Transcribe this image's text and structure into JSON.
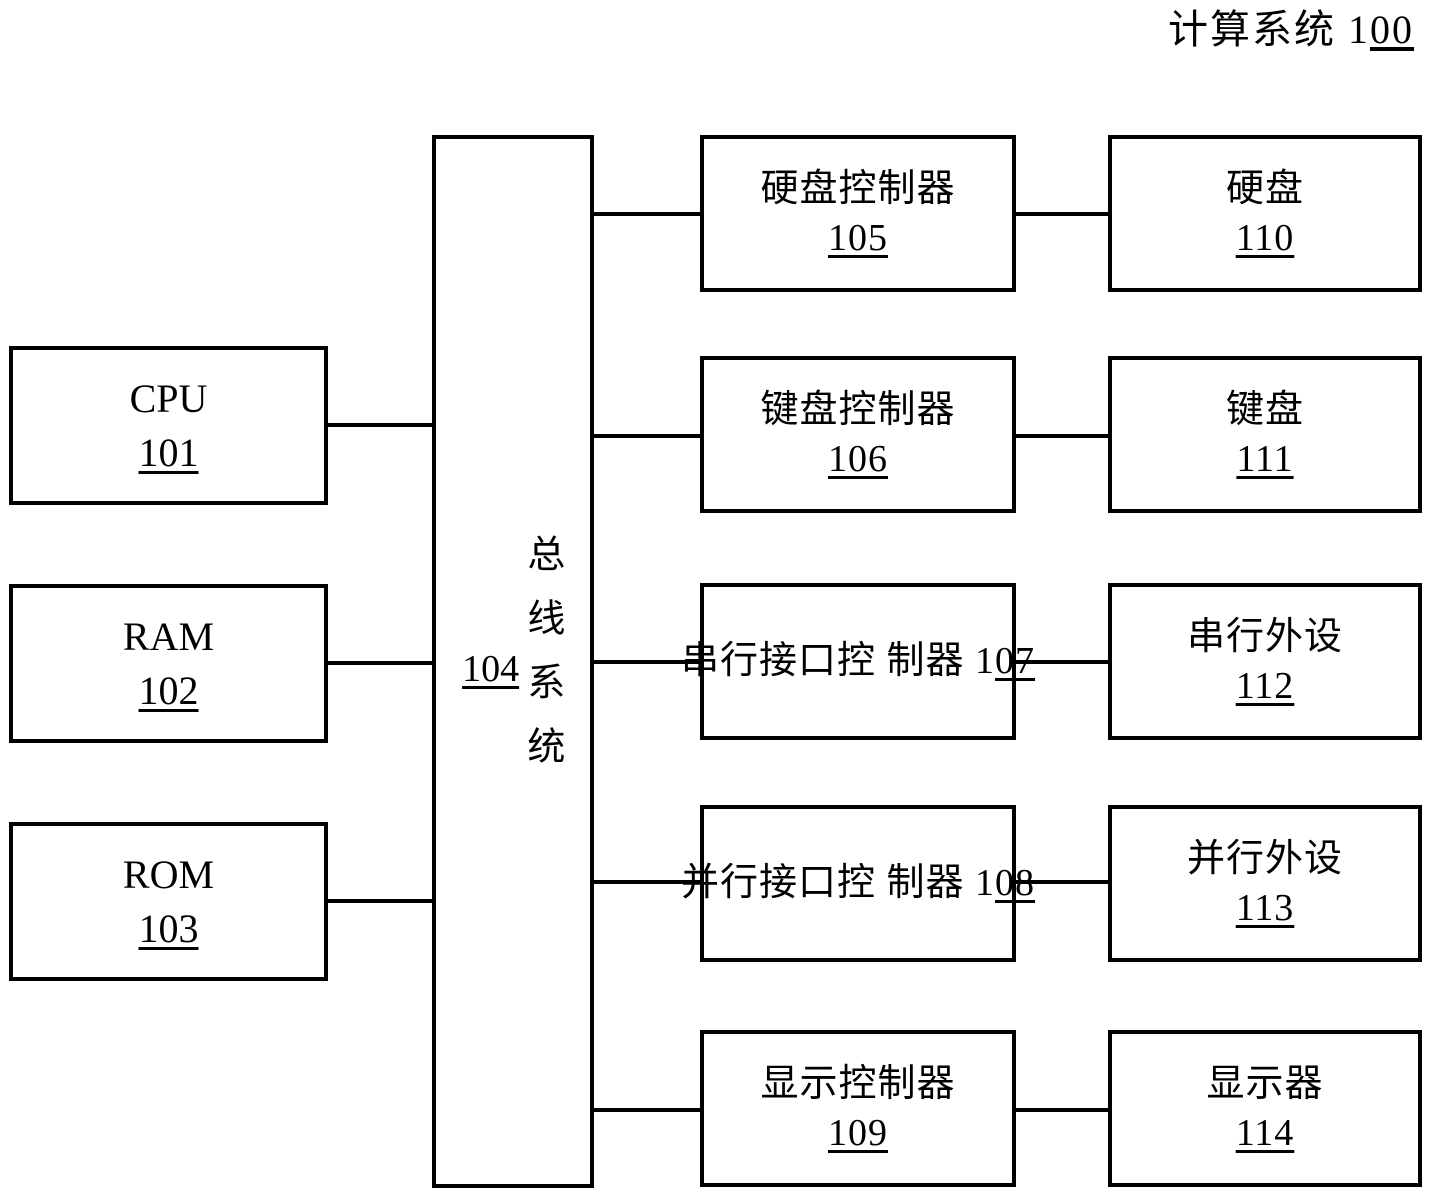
{
  "figure": {
    "title_text": "计算系统 ",
    "title_num_prefix": "1",
    "title_num_underlined": "00"
  },
  "core": {
    "cpu": {
      "label": "CPU",
      "id": "101"
    },
    "ram": {
      "label": "RAM",
      "id": "102"
    },
    "rom": {
      "label": "ROM",
      "id": "103"
    }
  },
  "bus": {
    "label": "总线系统",
    "id": "104"
  },
  "rows": [
    {
      "controller": {
        "label": "硬盘控制器",
        "id": "105",
        "inline": false
      },
      "device": {
        "label": "硬盘",
        "id": "110"
      }
    },
    {
      "controller": {
        "label": "键盘控制器",
        "id": "106",
        "inline": false
      },
      "device": {
        "label": "键盘",
        "id": "111"
      }
    },
    {
      "controller": {
        "label": "串行接口控\n制器 ",
        "id_prefix": "1",
        "id_underlined": "07",
        "inline": true
      },
      "device": {
        "label": "串行外设",
        "id": "112"
      }
    },
    {
      "controller": {
        "label": "并行接口控\n制器 ",
        "id_prefix": "1",
        "id_underlined": "08",
        "inline": true
      },
      "device": {
        "label": "并行外设",
        "id": "113"
      }
    },
    {
      "controller": {
        "label": "显示控制器",
        "id": "109",
        "inline": false
      },
      "device": {
        "label": "显示器",
        "id": "114"
      }
    }
  ],
  "colors": {
    "stroke": "#000000",
    "background": "#ffffff"
  }
}
